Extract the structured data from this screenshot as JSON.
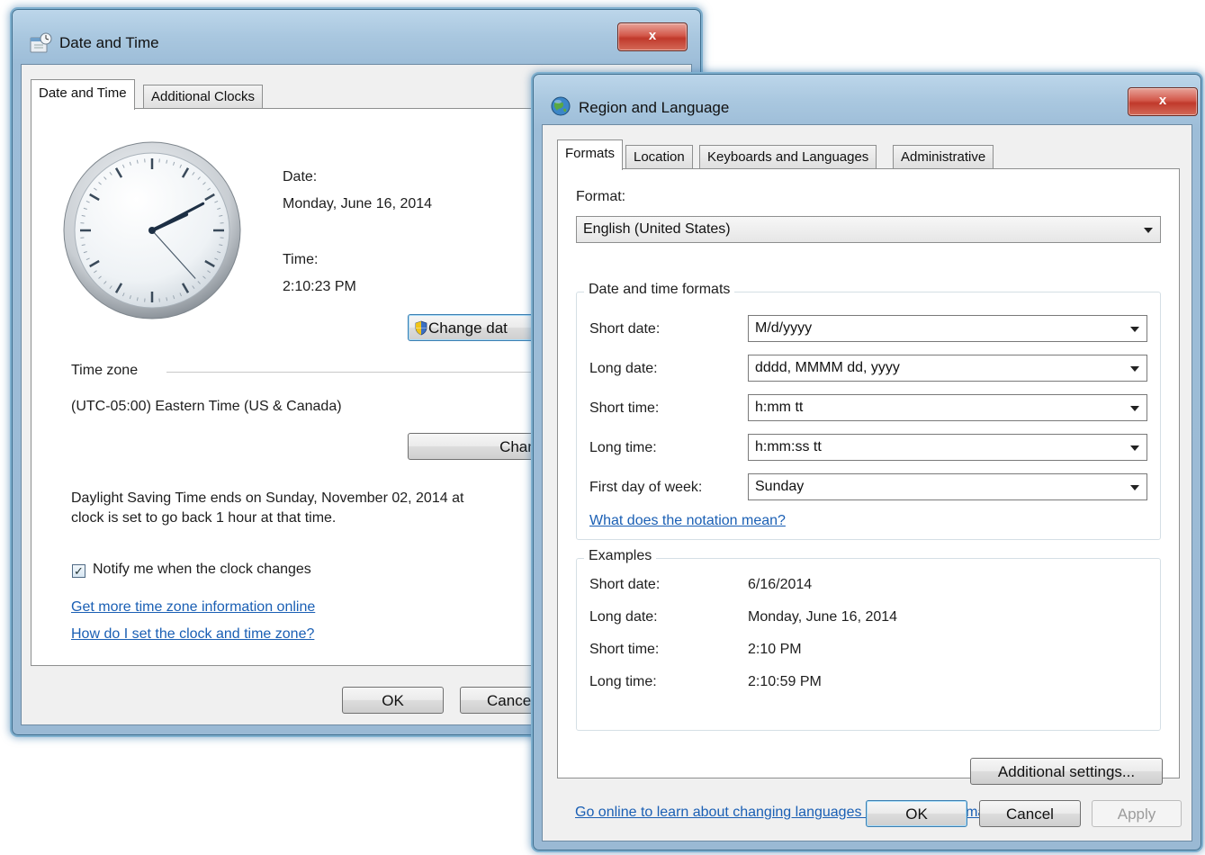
{
  "date_time_window": {
    "title": "Date and Time",
    "tabs": [
      {
        "label": "Date and Time",
        "active": true
      },
      {
        "label": "Additional Clocks",
        "active": false
      }
    ],
    "close_label": "x",
    "clock": {
      "hour": 2,
      "minute": 10,
      "second": 23
    },
    "date_label": "Date:",
    "date_value": "Monday, June 16, 2014",
    "time_label": "Time:",
    "time_value": "2:10:23 PM",
    "change_date_button": "Change dat",
    "time_zone_label": "Time zone",
    "time_zone_value": "(UTC-05:00) Eastern Time (US & Canada)",
    "change_time_zone_button": "Change tim",
    "dst_line1": "Daylight Saving Time ends on Sunday, November 02, 2014 at",
    "dst_line2": "clock is set to go back 1 hour at that time.",
    "notify_label": "Notify me when the clock changes",
    "notify_checked": true,
    "link_more_info": "Get more time zone information online",
    "link_how_set": "How do I set the clock and time zone?",
    "ok_button": "OK",
    "cancel_button": "Cancel"
  },
  "region_window": {
    "title": "Region and Language",
    "close_label": "x",
    "tabs": [
      {
        "label": "Formats",
        "active": true
      },
      {
        "label": "Location",
        "active": false
      },
      {
        "label": "Keyboards and Languages",
        "active": false
      },
      {
        "label": "Administrative",
        "active": false
      }
    ],
    "format_label": "Format:",
    "format_value": "English (United States)",
    "date_time_formats_label": "Date and time formats",
    "formats": [
      {
        "label": "Short date:",
        "value": "M/d/yyyy"
      },
      {
        "label": "Long date:",
        "value": "dddd, MMMM dd, yyyy"
      },
      {
        "label": "Short time:",
        "value": "h:mm tt"
      },
      {
        "label": "Long time:",
        "value": "h:mm:ss tt"
      },
      {
        "label": "First day of week:",
        "value": "Sunday"
      }
    ],
    "notation_link": "What does the notation mean?",
    "examples_label": "Examples",
    "examples": [
      {
        "label": "Short date:",
        "value": "6/16/2014"
      },
      {
        "label": "Long date:",
        "value": "Monday, June 16, 2014"
      },
      {
        "label": "Short time:",
        "value": "2:10 PM"
      },
      {
        "label": "Long time:",
        "value": "2:10:59 PM"
      }
    ],
    "additional_settings_button": "Additional settings...",
    "online_link": "Go online to learn about changing languages and regional formats",
    "ok_button": "OK",
    "cancel_button": "Cancel",
    "apply_button": "Apply"
  },
  "colors": {
    "link": "#1a5fb4",
    "title_bar": "#a9c7df",
    "close_button": "#c0392b"
  }
}
